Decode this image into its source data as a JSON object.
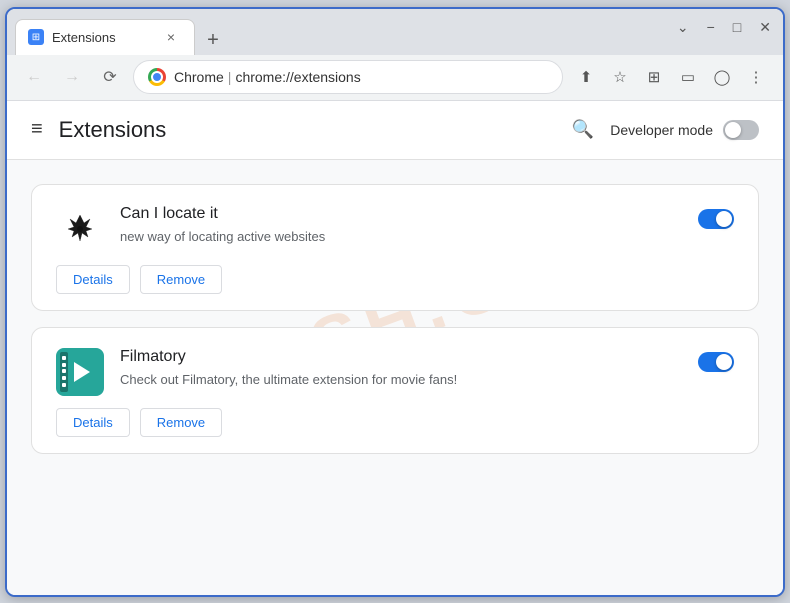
{
  "browser": {
    "tab_title": "Extensions",
    "tab_new_label": "+",
    "tab_close_label": "×"
  },
  "nav": {
    "back_title": "Back",
    "forward_title": "Forward",
    "reload_title": "Reload",
    "chrome_name": "Chrome",
    "address": "chrome://extensions",
    "separator": "|"
  },
  "window_controls": {
    "minimize": "−",
    "maximize": "□",
    "close": "✕",
    "dropdown": "⌄"
  },
  "page": {
    "title": "Extensions",
    "menu_icon": "≡",
    "search_icon": "🔍",
    "dev_mode_label": "Developer mode",
    "dev_mode_on": false
  },
  "extensions": [
    {
      "id": "can-locate-it",
      "name": "Can I locate it",
      "description": "new way of locating active websites",
      "enabled": true,
      "details_label": "Details",
      "remove_label": "Remove"
    },
    {
      "id": "filmatory",
      "name": "Filmatory",
      "description": "Check out Filmatory, the ultimate extension for movie fans!",
      "enabled": true,
      "details_label": "Details",
      "remove_label": "Remove"
    }
  ],
  "watermark": "FLASH.COM"
}
